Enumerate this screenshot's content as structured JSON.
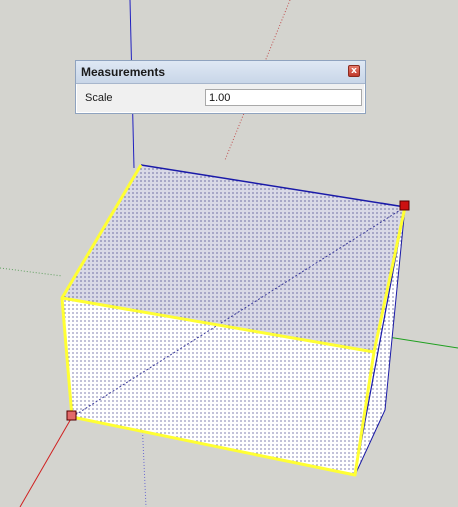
{
  "measurements_dialog": {
    "title": "Measurements",
    "close_glyph": "x",
    "field_label": "Scale",
    "field_value": "1.00"
  },
  "icons": {
    "close": "close-icon"
  },
  "colors": {
    "background": "#d4d4cf",
    "selection_edge": "#ffff33",
    "back_edges": "#1a1aa8",
    "axis_red": "#d02020",
    "axis_green": "#20a020",
    "axis_blue": "#2020c0",
    "grip": "#cc1111"
  }
}
